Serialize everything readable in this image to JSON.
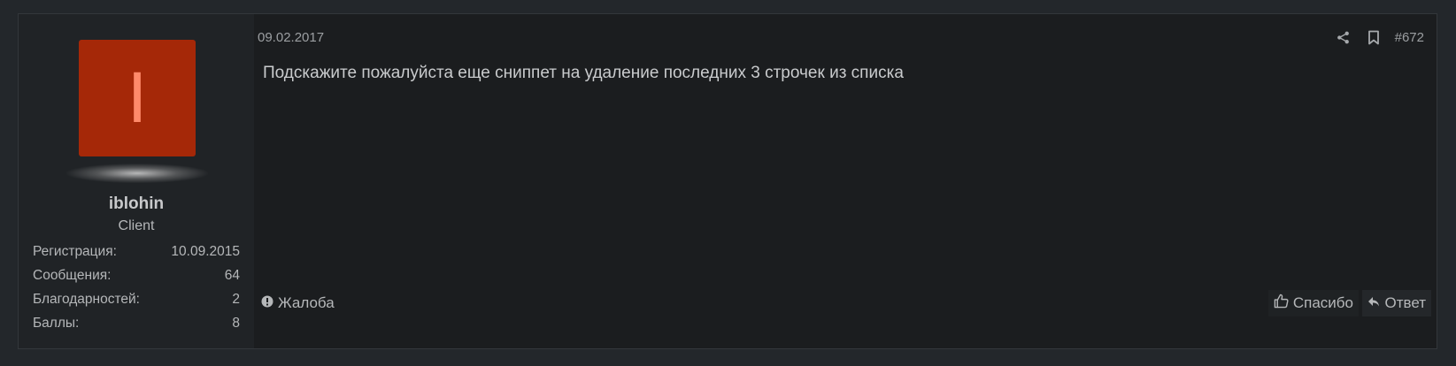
{
  "user": {
    "avatar_letter": "I",
    "username": "iblohin",
    "title": "Client",
    "stats": [
      {
        "label": "Регистрация:",
        "value": "10.09.2015"
      },
      {
        "label": "Сообщения:",
        "value": "64"
      },
      {
        "label": "Благодарностей:",
        "value": "2"
      },
      {
        "label": "Баллы:",
        "value": "8"
      }
    ]
  },
  "post": {
    "date": "09.02.2017",
    "number": "#672",
    "text": "Подскажите пожалуйста еще сниппет на удаление последних 3 строчек из списка"
  },
  "footer": {
    "report_label": "Жалоба",
    "like_label": "Спасибо",
    "reply_label": "Ответ"
  },
  "icons": {
    "report": "exclamation-circle-icon",
    "like": "thumbs-up-icon",
    "reply": "reply-arrow-icon",
    "share": "share-icon",
    "bookmark": "bookmark-icon"
  },
  "colors": {
    "avatar_bg": "#a52808",
    "avatar_letter": "#ff8a6a"
  }
}
